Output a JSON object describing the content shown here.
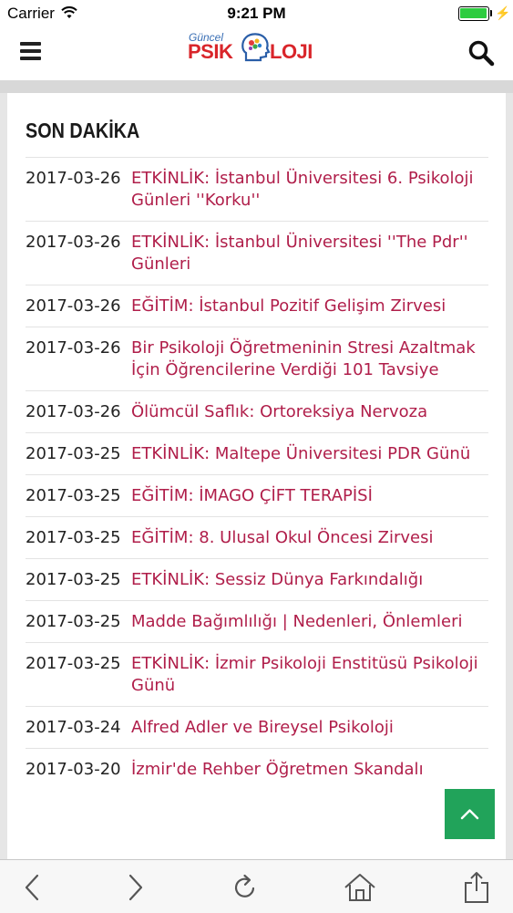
{
  "status_bar": {
    "carrier": "Carrier",
    "time": "9:21 PM"
  },
  "header": {
    "logo_small": "Güncel",
    "logo_left": "PSIK",
    "logo_right": "LOJI",
    "menu_icon": "hamburger-icon",
    "search_icon": "search-icon"
  },
  "section": {
    "title": "SON DAKİKA",
    "items": [
      {
        "date": "2017-03-26",
        "title": "ETKİNLİK: İstanbul Üniversitesi 6. Psikoloji Günleri ''Korku''"
      },
      {
        "date": "2017-03-26",
        "title": "ETKİNLİK: İstanbul Üniversitesi ''The Pdr'' Günleri"
      },
      {
        "date": "2017-03-26",
        "title": "EĞİTİM: İstanbul Pozitif Gelişim Zirvesi"
      },
      {
        "date": "2017-03-26",
        "title": "Bir Psikoloji Öğretmeninin Stresi Azaltmak İçin Öğrencilerine Verdiği 101 Tavsiye"
      },
      {
        "date": "2017-03-26",
        "title": "Ölümcül Saflık: Ortoreksiya Nervoza"
      },
      {
        "date": "2017-03-25",
        "title": "ETKİNLİK: Maltepe Üniversitesi PDR Günü"
      },
      {
        "date": "2017-03-25",
        "title": "EĞİTİM: İMAGO ÇİFT TERAPİSİ"
      },
      {
        "date": "2017-03-25",
        "title": "EĞİTİM: 8. Ulusal Okul Öncesi Zirvesi"
      },
      {
        "date": "2017-03-25",
        "title": "ETKİNLİK: Sessiz Dünya Farkındalığı"
      },
      {
        "date": "2017-03-25",
        "title": "Madde Bağımlılığı | Nedenleri, Önlemleri"
      },
      {
        "date": "2017-03-25",
        "title": "ETKİNLİK: İzmir Psikoloji Enstitüsü Psikoloji Günü"
      },
      {
        "date": "2017-03-24",
        "title": "Alfred Adler ve Bireysel Psikoloji"
      },
      {
        "date": "2017-03-20",
        "title": "İzmir'de Rehber Öğretmen Skandalı"
      }
    ]
  },
  "colors": {
    "link": "#b01e4a",
    "accent_green": "#21a35a",
    "battery": "#2ecc40"
  },
  "toolbar": {
    "icons": [
      "back-arrow-icon",
      "forward-arrow-icon",
      "reload-icon",
      "home-icon",
      "share-icon"
    ]
  }
}
